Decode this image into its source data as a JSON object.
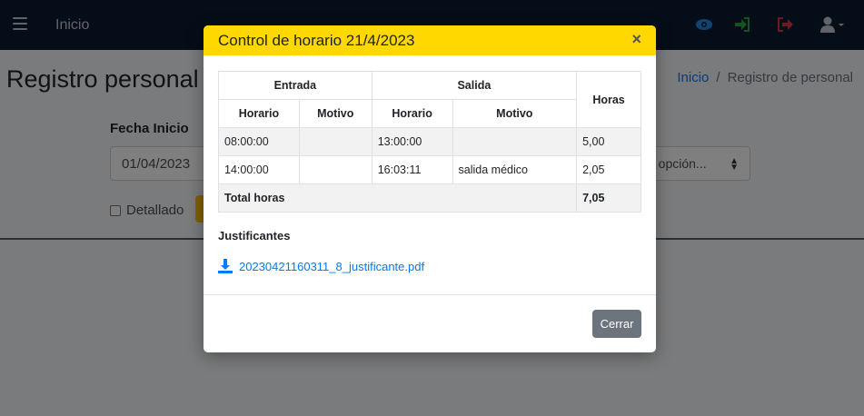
{
  "navbar": {
    "home_label": "Inicio",
    "icons": [
      "menu-icon",
      "eye-icon",
      "login-icon",
      "logout-icon",
      "user-icon"
    ],
    "colors": {
      "background": "#0b1a33",
      "eye": "#1e88e5",
      "login": "#28a745",
      "logout": "#dc3545"
    }
  },
  "page": {
    "title": "Registro personal",
    "breadcrumb": {
      "home": "Inicio",
      "separator": "/",
      "current": "Registro de personal"
    },
    "filters": {
      "fecha_inicio_label": "Fecha Inicio",
      "fecha_inicio_value": "01/04/2023",
      "select_value": "a opción...",
      "detallado_label": "Detallado"
    }
  },
  "modal": {
    "title": "Control de horario 21/4/2023",
    "close_symbol": "×",
    "header_color": "#ffd800",
    "table": {
      "group_headers": {
        "entrada": "Entrada",
        "salida": "Salida",
        "horas": "Horas"
      },
      "sub_headers": [
        "Horario",
        "Motivo",
        "Horario",
        "Motivo"
      ],
      "rows": [
        {
          "entrada_horario": "08:00:00",
          "entrada_motivo": "",
          "salida_horario": "13:00:00",
          "salida_motivo": "",
          "horas": "5,00"
        },
        {
          "entrada_horario": "14:00:00",
          "entrada_motivo": "",
          "salida_horario": "16:03:11",
          "salida_motivo": "salida médico",
          "horas": "2,05"
        }
      ],
      "total_label": "Total horas",
      "total_value": "7,05"
    },
    "justificantes_title": "Justificantes",
    "file_name": "20230421160311_8_justificante.pdf",
    "close_button": "Cerrar"
  }
}
